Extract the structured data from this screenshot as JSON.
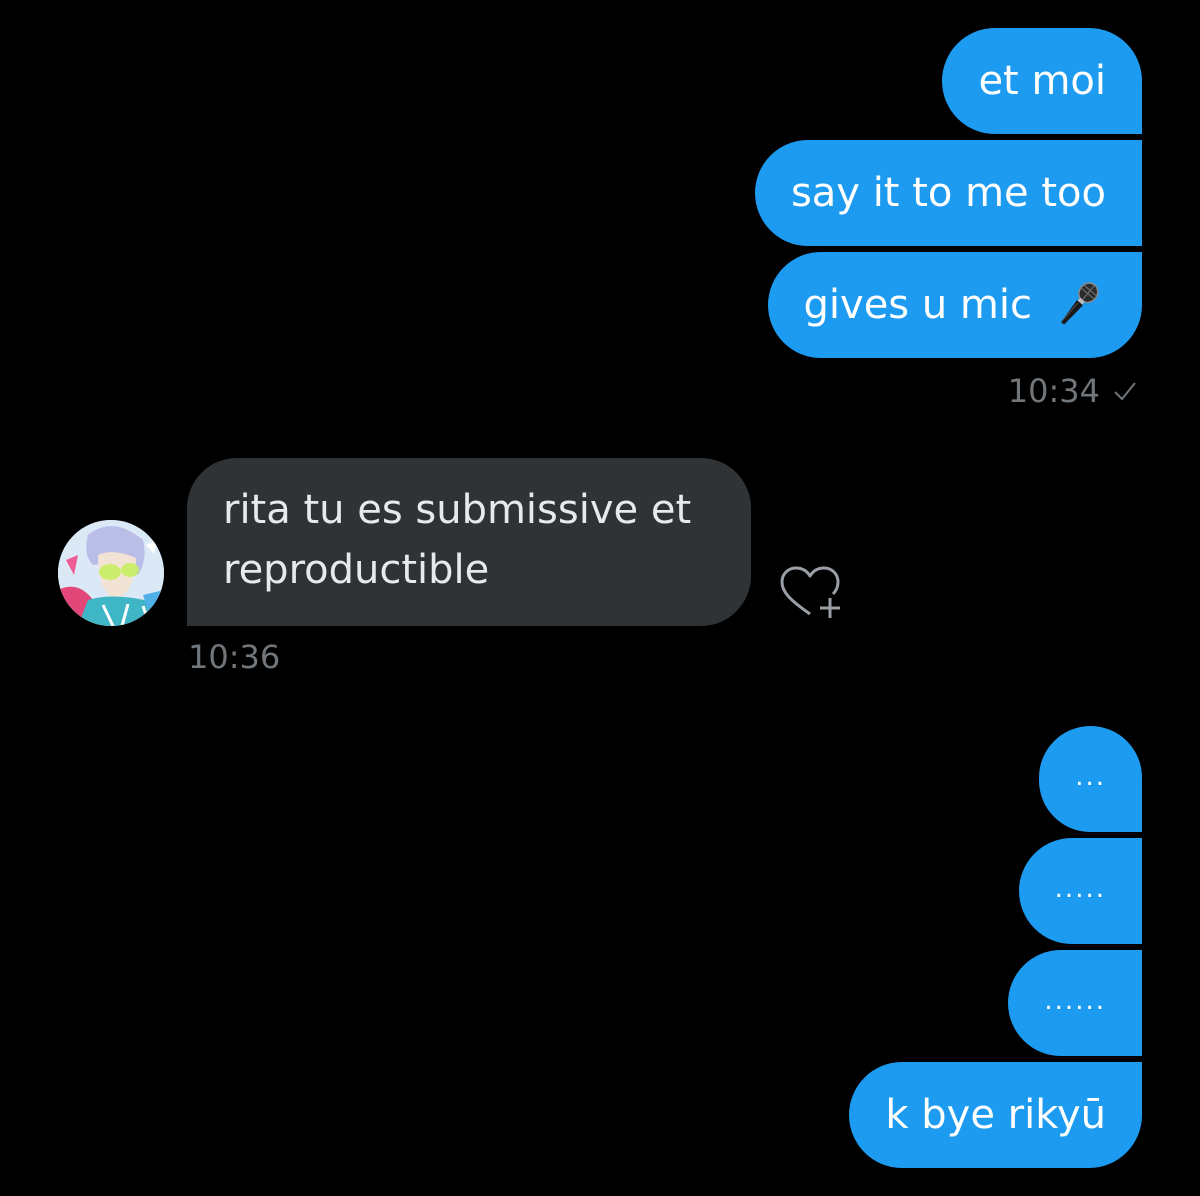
{
  "conversation": {
    "outgoing_group_1": [
      {
        "text": "et moi"
      },
      {
        "text": "say it to me too"
      },
      {
        "text": "gives u mic",
        "emoji": "microphone-icon"
      }
    ],
    "outgoing_group_1_time": "10:34",
    "outgoing_group_1_status": "check-icon",
    "incoming": {
      "line1": "rita tu es submissive et",
      "line2": "reproductible",
      "time": "10:36",
      "reaction_button": "heart-add-icon",
      "avatar": "avatar"
    },
    "outgoing_group_2": [
      {
        "text": "..."
      },
      {
        "text": "....."
      },
      {
        "text": "......"
      },
      {
        "text": "k bye rikyū"
      }
    ]
  },
  "colors": {
    "background": "#000000",
    "outgoing_bubble": "#1D9BF0",
    "incoming_bubble": "#2F3336",
    "timestamp": "#71767B",
    "text_light": "#FFFFFF"
  }
}
